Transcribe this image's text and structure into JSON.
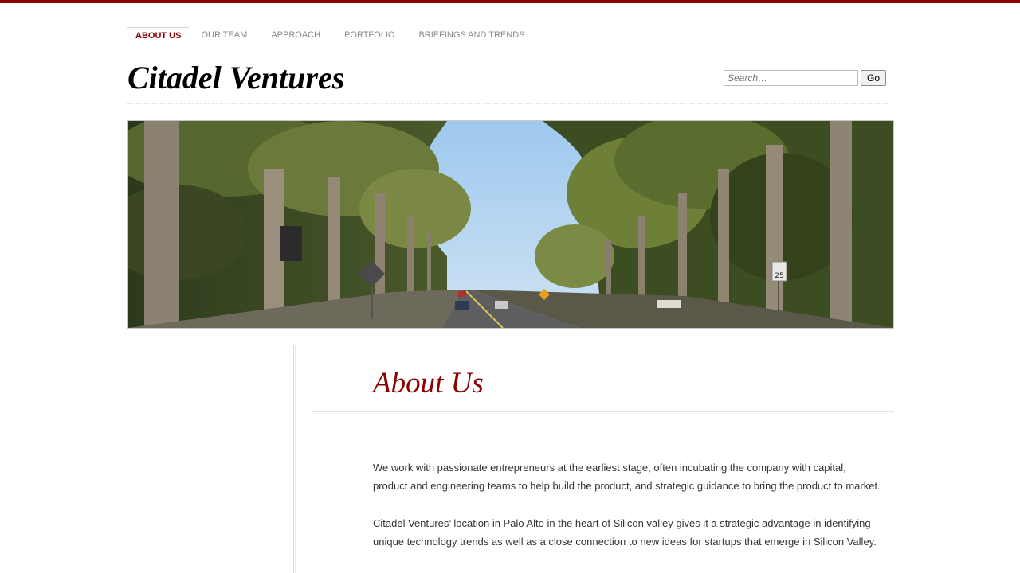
{
  "nav": {
    "items": [
      {
        "label": "ABOUT US",
        "active": true
      },
      {
        "label": "OUR TEAM",
        "active": false
      },
      {
        "label": "APPROACH",
        "active": false
      },
      {
        "label": "PORTFOLIO",
        "active": false
      },
      {
        "label": "BRIEFINGS AND TRENDS",
        "active": false
      }
    ]
  },
  "site": {
    "title": "Citadel Ventures"
  },
  "search": {
    "placeholder": "Search…",
    "value": "",
    "button_label": "Go"
  },
  "banner": {
    "description_icon": "palm-tree-avenue-photo",
    "speed_sign": "25"
  },
  "page": {
    "title": "About Us",
    "paragraphs": [
      "We work with passionate entrepreneurs at the earliest stage, often incubating the company with capital, product and engineering teams to help build the product, and strategic guidance to bring the product to market.",
      "Citadel Ventures’ location in Palo Alto in the heart of Silicon valley gives it a strategic advantage in identifying unique technology trends as well as a close connection to new ideas for startups that emerge in Silicon Valley."
    ]
  },
  "colors": {
    "accent": "#8b0000",
    "nav_text": "#8a8a8a",
    "body_text": "#333333"
  }
}
